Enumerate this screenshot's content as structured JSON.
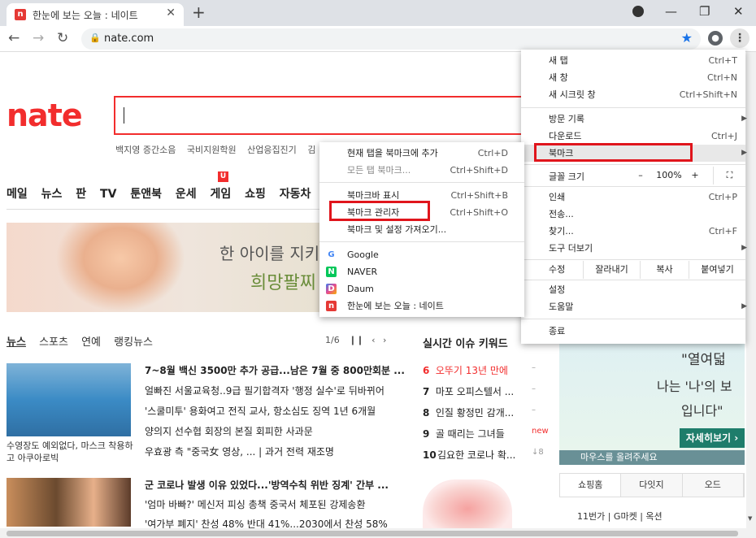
{
  "browser": {
    "tab_title": "한눈에 보는 오늘 : 네이트",
    "tab_favicon": "n",
    "tab_close": "✕",
    "new_tab": "+",
    "url": "nate.com",
    "back": "←",
    "forward": "→",
    "reload": "↻",
    "lock": "🔒",
    "star": "★",
    "menu_dots": "⋮",
    "win_min": "—",
    "win_restore": "❐",
    "win_close": "✕",
    "profile_icon": "●"
  },
  "page": {
    "logo": "nate",
    "search_keywords": [
      "백지영 증간소음",
      "국비지원학원",
      "산업응집진기",
      "김"
    ],
    "gnb": [
      "메일",
      "뉴스",
      "판",
      "TV",
      "툰앤북",
      "운세",
      "게임",
      "쇼핑",
      "자동차"
    ],
    "game_badge": "U",
    "banner_text1": "한 아이를 지키는",
    "banner_text2": "희망팔찌",
    "news_tabs": [
      "뉴스",
      "스포츠",
      "연예",
      "랭킹뉴스"
    ],
    "pager": "1/6",
    "caption1": "수영장도 예외없다, 마스크 착용하고 아쿠아로빅",
    "headlines": [
      "7~8월 백신 3500만 추가 공급...남은 7월 중 800만회분 ...",
      "얼빠진 서울교육청..9급 필기합격자 '행정 실수'로 뒤바뀌어",
      "'스쿨미투' 용화여고 전직 교사, 항소심도 징역 1년 6개월",
      "양의지 선수협 회장의 본질 회피한 사과문",
      "우효광 측 \"중국女 영상, ...  |  과거 전력 재조명",
      "군 코로나 발생 이유 있었다...'방역수칙 위반 징계' 간부 ...",
      "'엄마 바빠?' 메신저 피싱 총책 중국서 체포된 강제송환",
      "'여가부 폐지' 찬성 48% 반대 41%...2030에서 찬성 58%"
    ],
    "realtime_title": "실시간 이슈 키워드",
    "realtime": [
      {
        "rank": "6",
        "text": "오뚜기 13년 만에",
        "status": "–"
      },
      {
        "rank": "7",
        "text": "마포 오피스텔서 ...",
        "status": "–"
      },
      {
        "rank": "8",
        "text": "인질 황정민 감개...",
        "status": "–"
      },
      {
        "rank": "9",
        "text": "골 때리는 그녀들",
        "status": "new"
      },
      {
        "rank": "10",
        "text": "김요한 코로나 확...",
        "status": "↓8"
      }
    ],
    "ad_q1": "\"열여덟",
    "ad_q2": "나는 '나'의 보",
    "ad_q3": "입니다\"",
    "ad_more": "자세히보기 ›",
    "ad_bar": "마우스를 올려주세요",
    "shop_tabs": [
      "쇼핑홈",
      "다잇지",
      "오드"
    ],
    "shop_line": "11번가 | G마켓 | 옥션"
  },
  "chrome_menu": {
    "items": [
      {
        "label": "새 탭",
        "shortcut": "Ctrl+T"
      },
      {
        "label": "새 창",
        "shortcut": "Ctrl+N"
      },
      {
        "label": "새 시크릿 창",
        "shortcut": "Ctrl+Shift+N"
      },
      {
        "label": "방문 기록",
        "shortcut": ""
      },
      {
        "label": "다운로드",
        "shortcut": "Ctrl+J"
      },
      {
        "label": "북마크",
        "shortcut": ""
      },
      {
        "label": "인쇄",
        "shortcut": "Ctrl+P"
      },
      {
        "label": "전송...",
        "shortcut": ""
      },
      {
        "label": "찾기...",
        "shortcut": "Ctrl+F"
      },
      {
        "label": "도구 더보기",
        "shortcut": ""
      },
      {
        "label": "설정",
        "shortcut": ""
      },
      {
        "label": "도움말",
        "shortcut": ""
      },
      {
        "label": "종료",
        "shortcut": ""
      }
    ],
    "zoom_label": "글꼴 크기",
    "zoom_minus": "–",
    "zoom_value": "100%",
    "zoom_plus": "+",
    "fullscreen": "⛶",
    "edit_label": "수정",
    "cut": "잘라내기",
    "copy": "복사",
    "paste": "붙여넣기",
    "arrow": "▶"
  },
  "bookmark_menu": {
    "items": [
      {
        "label": "현재 탭을 북마크에 추가",
        "shortcut": "Ctrl+D"
      },
      {
        "label": "모든 탭 북마크...",
        "shortcut": "Ctrl+Shift+D"
      },
      {
        "label": "북마크바 표시",
        "shortcut": "Ctrl+Shift+B"
      },
      {
        "label": "북마크 관리자",
        "shortcut": "Ctrl+Shift+O"
      },
      {
        "label": "북마크 및 설정 가져오기...",
        "shortcut": ""
      },
      {
        "label": "Google",
        "shortcut": ""
      },
      {
        "label": "NAVER",
        "shortcut": ""
      },
      {
        "label": "Daum",
        "shortcut": ""
      },
      {
        "label": "한눈에 보는 오늘 : 네이트",
        "shortcut": ""
      }
    ],
    "favicons": [
      "G",
      "N",
      "D",
      "n"
    ]
  },
  "colors": {
    "highlight": "#e0151c",
    "nate_red": "#f22d2d",
    "chrome_blue": "#1a73e8"
  }
}
